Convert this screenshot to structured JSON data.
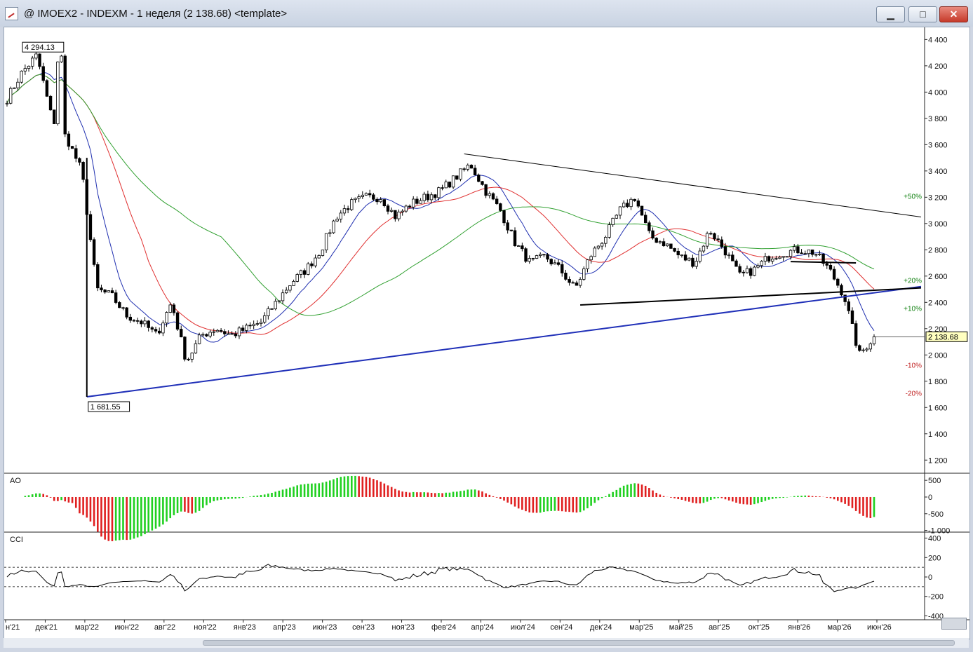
{
  "window": {
    "title": "@ IMOEX2 - INDEXM - 1 неделя (2 138.68) <template>",
    "minimize_label": "▁",
    "maximize_label": "□",
    "close_label": "✕"
  },
  "colors": {
    "candle": "#000000",
    "ma_fast": "#2030b0",
    "ma_mid": "#e03030",
    "ma_slow": "#30a030",
    "support_line": "#2030b8",
    "ao_up": "#20d020",
    "ao_down": "#e02020",
    "cci": "#000000",
    "pct_plus": "#108010",
    "pct_minus": "#c02020"
  },
  "chart_data": [
    {
      "type": "candlestick",
      "title": "IMOEX2 - INDEXM - 1 неделя",
      "last_value_label": "2 138.68",
      "x_tick_labels": [
        "н'21",
        "дек'21",
        "мар'22",
        "июн'22",
        "авг'22",
        "ноя'22",
        "янв'23",
        "апр'23",
        "июн'23",
        "сен'23",
        "ноя'23",
        "фев'24",
        "апр'24",
        "июл'24",
        "сен'24",
        "дек'24",
        "мар'25",
        "май'25",
        "авг'25",
        "окт'25",
        "янв'26",
        "мар'26",
        "июн'26"
      ],
      "y_ticks": [
        1200,
        1400,
        1600,
        1800,
        2000,
        2200,
        2400,
        2600,
        2800,
        3000,
        3200,
        3400,
        3600,
        3800,
        4000,
        4200,
        4400
      ],
      "y_tick_labels": [
        "1 200",
        "1 400",
        "1 600",
        "1 800",
        "2 000",
        "2 200",
        "2 400",
        "2 600",
        "2 800",
        "3 000",
        "3 200",
        "3 400",
        "3 600",
        "3 800",
        "4 000",
        "4 200",
        "4 400"
      ],
      "ylim": [
        1100,
        4450
      ],
      "price_series": [
        {
          "x": "н'21",
          "y": 3950
        },
        {
          "x": "н'21+",
          "y": 4150
        },
        {
          "x": "окт'21",
          "y": 4280
        },
        {
          "x": "дек'21",
          "y": 3800
        },
        {
          "x": "янв'22",
          "y": 3650
        },
        {
          "x": "фев'22",
          "y": 3400
        },
        {
          "x": "мар'22",
          "y": 2500
        },
        {
          "x": "апр'22",
          "y": 2450
        },
        {
          "x": "май'22",
          "y": 2300
        },
        {
          "x": "июн'22",
          "y": 2250
        },
        {
          "x": "июл'22",
          "y": 2150
        },
        {
          "x": "авг'22",
          "y": 2400
        },
        {
          "x": "сен'22",
          "y": 1950
        },
        {
          "x": "окт'22",
          "y": 2150
        },
        {
          "x": "ноя'22",
          "y": 2200
        },
        {
          "x": "дек'22",
          "y": 2150
        },
        {
          "x": "янв'23",
          "y": 2200
        },
        {
          "x": "фев'23",
          "y": 2250
        },
        {
          "x": "мар'23",
          "y": 2400
        },
        {
          "x": "апр'23",
          "y": 2550
        },
        {
          "x": "май'23",
          "y": 2650
        },
        {
          "x": "июн'23",
          "y": 2800
        },
        {
          "x": "июл'23",
          "y": 3050
        },
        {
          "x": "авг'23",
          "y": 3150
        },
        {
          "x": "сен'23",
          "y": 3200
        },
        {
          "x": "окт'23",
          "y": 3200
        },
        {
          "x": "ноя'23",
          "y": 3050
        },
        {
          "x": "дек'23",
          "y": 3150
        },
        {
          "x": "янв'24",
          "y": 3200
        },
        {
          "x": "фев'24",
          "y": 3250
        },
        {
          "x": "мар'24",
          "y": 3350
        },
        {
          "x": "апр'24",
          "y": 3450
        },
        {
          "x": "май'24",
          "y": 3250
        },
        {
          "x": "июн'24",
          "y": 3100
        },
        {
          "x": "июл'24",
          "y": 2850
        },
        {
          "x": "авг'24",
          "y": 2700
        },
        {
          "x": "сен'24",
          "y": 2750
        },
        {
          "x": "окт'24",
          "y": 2650
        },
        {
          "x": "ноя'24",
          "y": 2500
        },
        {
          "x": "дек'24",
          "y": 2750
        },
        {
          "x": "янв'25",
          "y": 2900
        },
        {
          "x": "фев'25",
          "y": 3100
        },
        {
          "x": "мар'25",
          "y": 3200
        },
        {
          "x": "апр'25",
          "y": 2900
        },
        {
          "x": "май'25",
          "y": 2850
        },
        {
          "x": "июн'25",
          "y": 2750
        },
        {
          "x": "июл'25",
          "y": 2700
        },
        {
          "x": "авг'25",
          "y": 2950
        },
        {
          "x": "сен'25",
          "y": 2800
        },
        {
          "x": "окт'25",
          "y": 2600
        },
        {
          "x": "ноя'25",
          "y": 2650
        },
        {
          "x": "дек'25",
          "y": 2750
        },
        {
          "x": "янв'26",
          "y": 2780
        },
        {
          "x": "фев'26",
          "y": 2800
        },
        {
          "x": "мар'26",
          "y": 2780
        },
        {
          "x": "апр'26",
          "y": 2650
        },
        {
          "x": "май'26",
          "y": 2450
        },
        {
          "x": "июн'26",
          "y": 2000
        },
        {
          "x": "июл'26",
          "y": 2138.68
        }
      ],
      "annotations": [
        {
          "label": "4 294.13",
          "value": 4294.13
        },
        {
          "label": "1 681.55",
          "value": 1681.55
        },
        {
          "label": "2 138.68",
          "value": 2138.68
        }
      ],
      "percent_levels": [
        {
          "label": "+50%",
          "value": 3210
        },
        {
          "label": "+20%",
          "value": 2570
        },
        {
          "label": "+10%",
          "value": 2355
        },
        {
          "label": "-10%",
          "value": 1925
        },
        {
          "label": "-20%",
          "value": 1710
        }
      ],
      "grid": false,
      "legend": "none"
    },
    {
      "type": "bar",
      "title": "AO",
      "y_tick_labels": [
        "500",
        "0",
        "-500",
        "-1 000"
      ],
      "ylim": [
        -1050,
        650
      ]
    },
    {
      "type": "line",
      "title": "CCI",
      "y_tick_labels": [
        "400",
        "200",
        "0",
        "-200",
        "-400"
      ],
      "ylim": [
        -440,
        440
      ],
      "reference_lines": [
        100,
        -100
      ]
    }
  ]
}
